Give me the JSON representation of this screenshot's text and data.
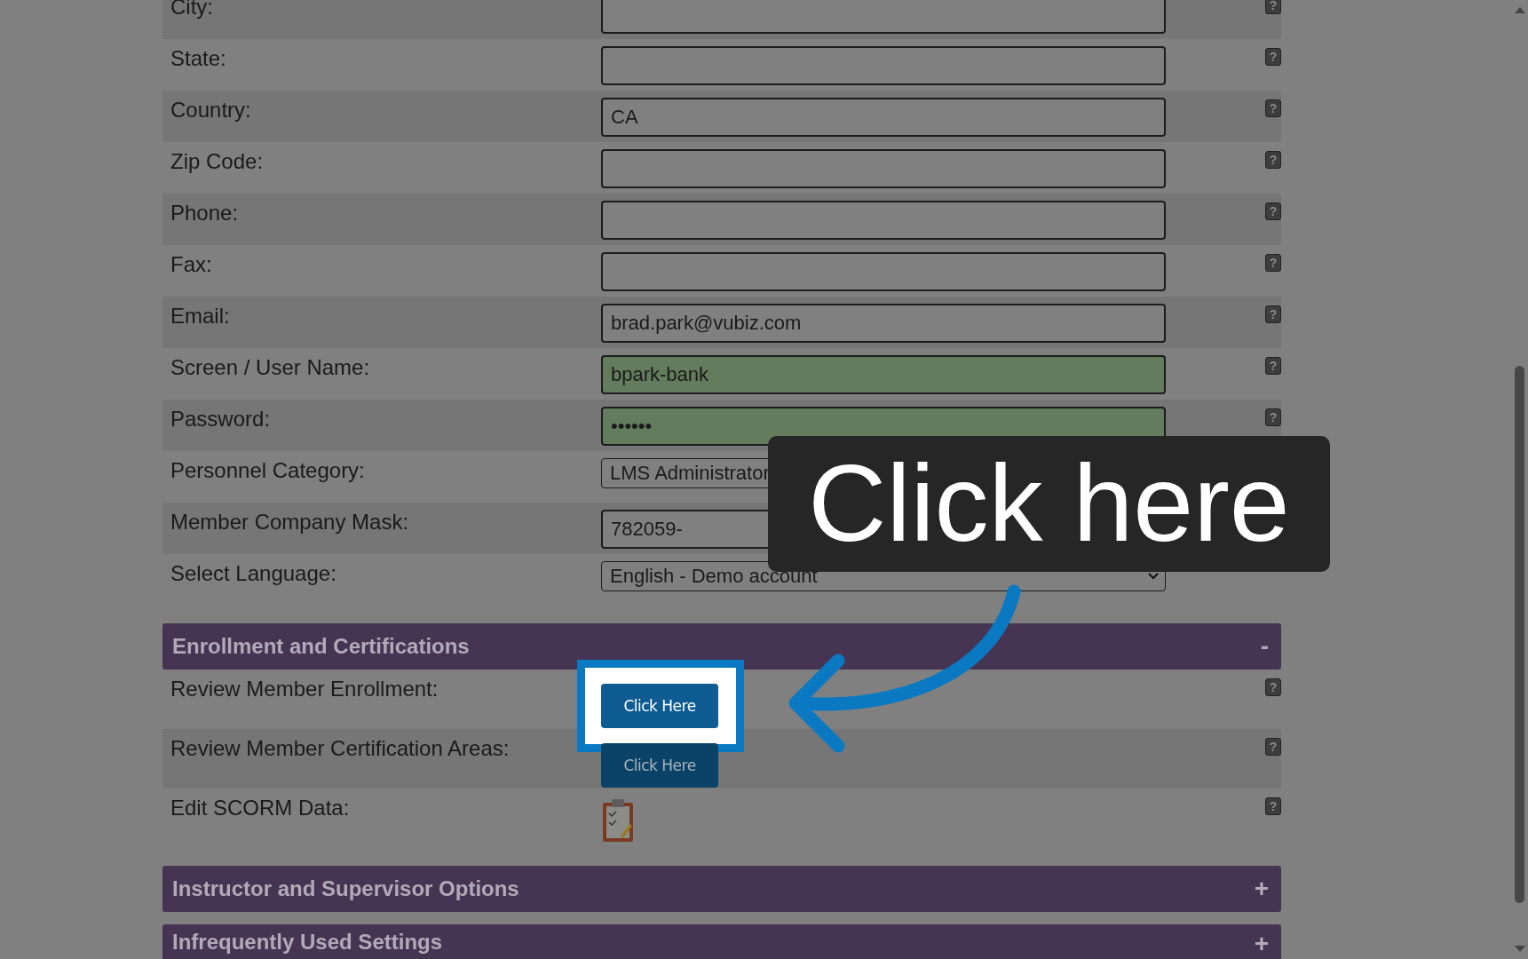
{
  "fields": [
    {
      "label": "City:",
      "kind": "text",
      "filled": false,
      "help": "?"
    },
    {
      "label": "State:",
      "kind": "text",
      "filled": false,
      "help": "?"
    },
    {
      "label": "Country:",
      "kind": "text",
      "value": "CA",
      "filled": false,
      "help": "?"
    },
    {
      "label": "Zip Code:",
      "kind": "text",
      "filled": false,
      "help": "?"
    },
    {
      "label": "Phone:",
      "kind": "text",
      "filled": false,
      "help": "?"
    },
    {
      "label": "Fax:",
      "kind": "text",
      "filled": false,
      "help": "?"
    },
    {
      "label": "Email:",
      "kind": "text",
      "value": "brad.park@vubiz.com",
      "filled": false,
      "help": "?"
    },
    {
      "label": "Screen / User Name:",
      "kind": "text",
      "value": "bpark-bank",
      "filled": true,
      "help": "?"
    },
    {
      "label": "Password:",
      "kind": "text",
      "value": "••••••",
      "filled": true,
      "help": "?"
    },
    {
      "label": "Personnel Category:",
      "kind": "select",
      "value": "LMS Administrator"
    },
    {
      "label": "Member Company Mask:",
      "kind": "text",
      "value": "782059-",
      "filled": false
    },
    {
      "label": "Select Language:",
      "kind": "select",
      "value": "English - Demo account",
      "caret": true
    }
  ],
  "sections": [
    {
      "title": "Enrollment and Certifications",
      "toggle": "-",
      "expanded": true,
      "rows": [
        {
          "label": "Review Member Enrollment:",
          "kind": "button",
          "button": "Click Here",
          "spotlight": true,
          "help": "?"
        },
        {
          "label": "Review Member Certification Areas:",
          "kind": "button",
          "button": "Click Here",
          "spotlight": false,
          "help": "?"
        },
        {
          "label": "Edit SCORM Data:",
          "kind": "icon",
          "help": "?"
        }
      ]
    },
    {
      "title": "Instructor and Supervisor Options",
      "toggle": "+",
      "expanded": false
    },
    {
      "title": "Infrequently Used Settings",
      "toggle": "+",
      "expanded": false
    }
  ],
  "callout": {
    "text": "Click here"
  }
}
